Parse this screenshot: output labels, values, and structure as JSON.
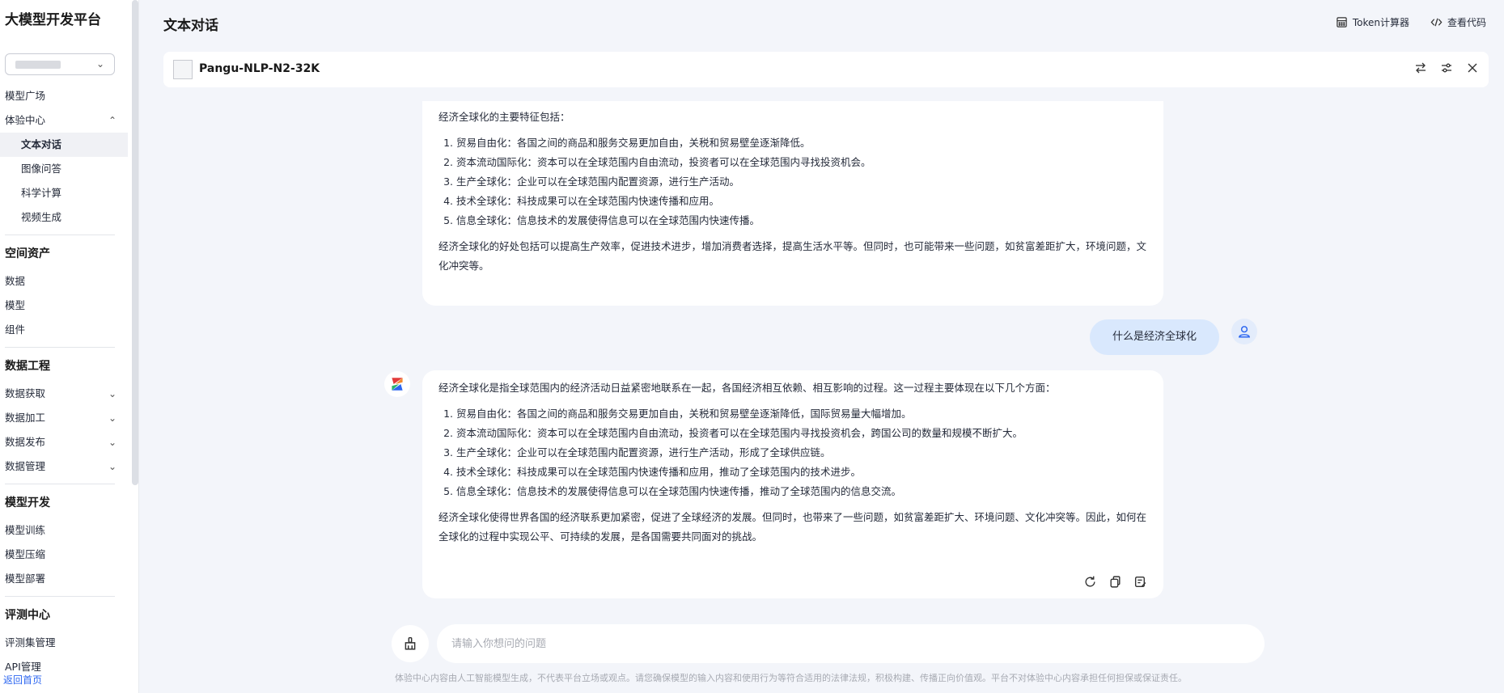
{
  "sidebar": {
    "brand": "大模型开发平台",
    "experience_center": {
      "label": "体验中心",
      "items": [
        "文本对话",
        "图像问答",
        "科学计算",
        "视频生成"
      ]
    },
    "model_plaza": "模型广场",
    "space_assets": {
      "label": "空间资产",
      "items": [
        "数据",
        "模型",
        "组件"
      ]
    },
    "data_engineering": {
      "label": "数据工程",
      "items": [
        "数据获取",
        "数据加工",
        "数据发布",
        "数据管理"
      ]
    },
    "model_dev": {
      "label": "模型开发",
      "items": [
        "模型训练",
        "模型压缩",
        "模型部署"
      ]
    },
    "eval_center": {
      "label": "评测中心",
      "items": [
        "评测集管理",
        "API管理"
      ]
    },
    "back_home": "返回首页"
  },
  "header": {
    "title": "文本对话",
    "token_calc": "Token计算器",
    "view_code": "查看代码"
  },
  "model": {
    "name": "Pangu-NLP-N2-32K"
  },
  "messages": {
    "first": {
      "intro": "经济全球化的主要特征包括：",
      "items": [
        "贸易自由化：各国之间的商品和服务交易更加自由，关税和贸易壁垒逐渐降低。",
        "资本流动国际化：资本可以在全球范围内自由流动，投资者可以在全球范围内寻找投资机会。",
        "生产全球化：企业可以在全球范围内配置资源，进行生产活动。",
        "技术全球化：科技成果可以在全球范围内快速传播和应用。",
        "信息全球化：信息技术的发展使得信息可以在全球范围内快速传播。"
      ],
      "outro": "经济全球化的好处包括可以提高生产效率，促进技术进步，增加消费者选择，提高生活水平等。但同时，也可能带来一些问题，如贫富差距扩大，环境问题，文化冲突等。"
    },
    "user": "什么是经济全球化",
    "second": {
      "intro": "经济全球化是指全球范围内的经济活动日益紧密地联系在一起，各国经济相互依赖、相互影响的过程。这一过程主要体现在以下几个方面：",
      "items": [
        "贸易自由化：各国之间的商品和服务交易更加自由，关税和贸易壁垒逐渐降低，国际贸易量大幅增加。",
        "资本流动国际化：资本可以在全球范围内自由流动，投资者可以在全球范围内寻找投资机会，跨国公司的数量和规模不断扩大。",
        "生产全球化：企业可以在全球范围内配置资源，进行生产活动，形成了全球供应链。",
        "技术全球化：科技成果可以在全球范围内快速传播和应用，推动了全球范围内的技术进步。",
        "信息全球化：信息技术的发展使得信息可以在全球范围内快速传播，推动了全球范围内的信息交流。"
      ],
      "outro": "经济全球化使得世界各国的经济联系更加紧密，促进了全球经济的发展。但同时，也带来了一些问题，如贫富差距扩大、环境问题、文化冲突等。因此，如何在全球化的过程中实现公平、可持续的发展，是各国需要共同面对的挑战。"
    }
  },
  "input": {
    "placeholder": "请输入你想问的问题"
  },
  "disclaimer": "体验中心内容由人工智能模型生成，不代表平台立场或观点。请您确保模型的输入内容和使用行为等符合适用的法律法规，积极构建、传播正向价值观。平台不对体验中心内容承担任何担保或保证责任。",
  "icons": [
    "chevron-down-icon",
    "chevron-up-icon",
    "calculator-icon",
    "code-icon",
    "swap-icon",
    "sliders-icon",
    "close-icon",
    "user-icon",
    "pangu-logo-icon",
    "refresh-icon",
    "copy-icon",
    "edit-note-icon",
    "broom-icon"
  ]
}
